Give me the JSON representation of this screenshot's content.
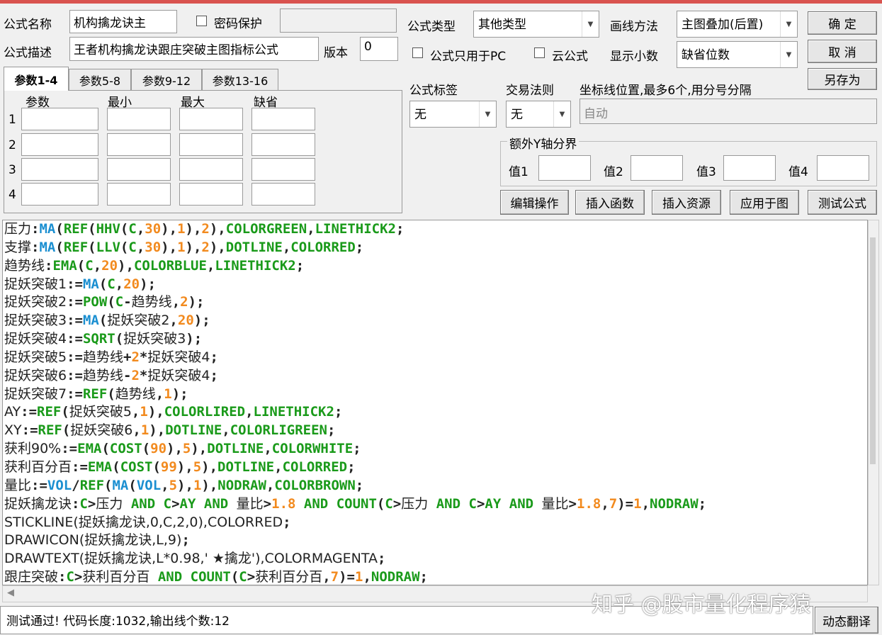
{
  "form": {
    "name_label": "公式名称",
    "name_value": "机构擒龙诀主",
    "password_label": "密码保护",
    "desc_label": "公式描述",
    "desc_value": "王者机构擒龙诀跟庄突破主图指标公式",
    "version_label": "版本",
    "version_value": "0",
    "type_label": "公式类型",
    "type_value": "其他类型",
    "draw_label": "画线方法",
    "draw_value": "主图叠加(后置)",
    "pc_only_label": "公式只用于PC",
    "cloud_label": "云公式",
    "decimal_label": "显示小数",
    "decimal_value": "缺省位数",
    "tag_label": "公式标签",
    "tag_value": "无",
    "rule_label": "交易法则",
    "rule_value": "无",
    "axis_label": "坐标线位置,最多6个,用分号分隔",
    "axis_value": "自动",
    "y_group_label": "额外Y轴分界",
    "y_values": [
      "值1",
      "值2",
      "值3",
      "值4"
    ]
  },
  "buttons": {
    "ok": "确 定",
    "cancel": "取 消",
    "save_as": "另存为",
    "edit": "编辑操作",
    "insert_func": "插入函数",
    "insert_res": "插入资源",
    "apply": "应用于图",
    "test": "测试公式",
    "translate": "动态翻译"
  },
  "tabs": [
    "参数1-4",
    "参数5-8",
    "参数9-12",
    "参数13-16"
  ],
  "params": {
    "headers": [
      "参数",
      "最小",
      "最大",
      "缺省"
    ],
    "rows": [
      "1",
      "2",
      "3",
      "4"
    ]
  },
  "code_lines": [
    "压力:MA(REF(HHV(C,30),1),2),COLORGREEN,LINETHICK2;",
    "支撑:MA(REF(LLV(C,30),1),2),DOTLINE,COLORRED;",
    "趋势线:EMA(C,20),COLORBLUE,LINETHICK2;",
    "捉妖突破1:=MA(C,20);",
    "捉妖突破2:=POW(C-趋势线,2);",
    "捉妖突破3:=MA(捉妖突破2,20);",
    "捉妖突破4:=SQRT(捉妖突破3);",
    "捉妖突破5:=趋势线+2*捉妖突破4;",
    "捉妖突破6:=趋势线-2*捉妖突破4;",
    "捉妖突破7:=REF(趋势线,1);",
    "AY:=REF(捉妖突破5,1),COLORLIRED,LINETHICK2;",
    "XY:=REF(捉妖突破6,1),DOTLINE,COLORLIGREEN;",
    "获利90%:=EMA(COST(90),5),DOTLINE,COLORWHITE;",
    "获利百分百:=EMA(COST(99),5),DOTLINE,COLORRED;",
    "量比:=VOL/REF(MA(VOL,5),1),NODRAW,COLORBROWN;",
    "捉妖擒龙诀:C>压力 AND C>AY AND 量比>1.8 AND COUNT(C>压力 AND C>AY AND 量比>1.8,7)=1,NODRAW;",
    "STICKLINE(捉妖擒龙诀,0,C,2,0),COLORRED;",
    "DRAWICON(捉妖擒龙诀,L,9);",
    "DRAWTEXT(捉妖擒龙诀,L*0.98,' ★擒龙'),COLORMAGENTA;",
    "跟庄突破:C>获利百分百 AND COUNT(C>获利百分百,7)=1,NODRAW;"
  ],
  "status": "测试通过! 代码长度:1032,输出线个数:12",
  "watermark": "知乎 @股市量化程序猿"
}
